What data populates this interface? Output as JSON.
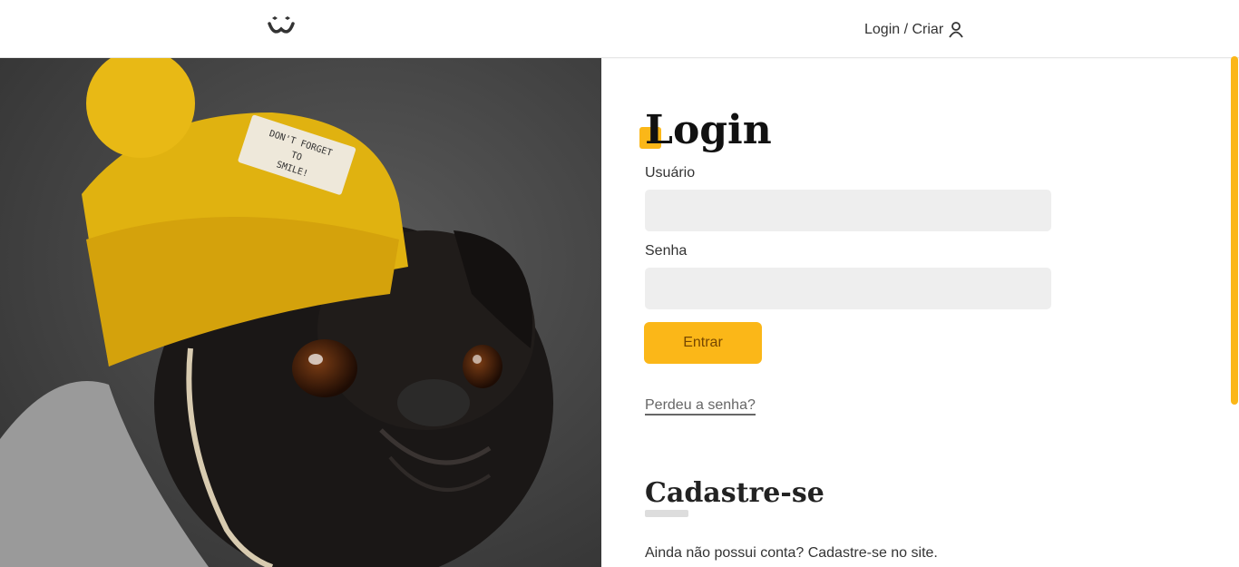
{
  "header": {
    "logo_icon": "dog-face-icon",
    "login_link_label": "Login / Criar",
    "user_icon": "user-icon"
  },
  "photo": {
    "description_icon": "pug-with-yellow-beanie-photo",
    "hat_label_lines": [
      "DON'T FORGET",
      "TO",
      "SMILE!"
    ]
  },
  "login": {
    "title": "Login",
    "username_label": "Usuário",
    "username_value": "",
    "password_label": "Senha",
    "password_value": "",
    "submit_label": "Entrar",
    "lost_password_link": "Perdeu a senha?"
  },
  "signup": {
    "title": "Cadastre-se",
    "text": "Ainda não possui conta? Cadastre-se no site."
  },
  "colors": {
    "accent": "#fbb718",
    "button_text": "#764701",
    "input_bg": "#eeeeee"
  }
}
